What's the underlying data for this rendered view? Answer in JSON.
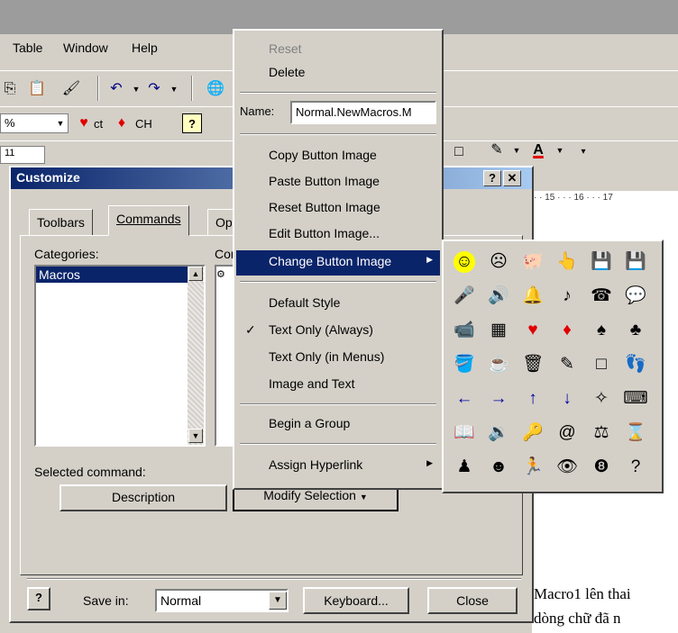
{
  "menu": {
    "table": "Table",
    "window": "Window",
    "help": "Help"
  },
  "toolbar": {
    "zoom_value": "%",
    "style_ct": "ct",
    "style_ch": "CH",
    "font_size": "11"
  },
  "ruler": {
    "text": "· · 15 · · · 16 · · · 17"
  },
  "document": {
    "line1": "Macro1 lên thai",
    "line2": "dòng chữ đã n"
  },
  "dialog": {
    "title": "Customize",
    "help_btn": "?",
    "close_btn": "✕",
    "tabs": [
      "Toolbars",
      "Commands",
      "Op"
    ],
    "categories_label": "Categories:",
    "categories_items": [
      "Macros"
    ],
    "commands_label": "Cor",
    "selected_command_label": "Selected command:",
    "description_btn": "Description",
    "modify_selection_btn": "Modify Selection",
    "save_in_label": "Save in:",
    "save_in_value": "Normal",
    "keyboard_btn": "Keyboard...",
    "close_btn_label": "Close",
    "help_icon_label": "?"
  },
  "context_menu": {
    "reset": "Reset",
    "delete": "Delete",
    "name_label": "Name:",
    "name_value": "Normal.NewMacros.M",
    "copy_button_image": "Copy Button Image",
    "paste_button_image": "Paste Button Image",
    "reset_button_image": "Reset Button Image",
    "edit_button_image": "Edit Button Image...",
    "change_button_image": "Change Button Image",
    "default_style": "Default Style",
    "text_only_always": "Text Only (Always)",
    "text_only_menus": "Text Only (in Menus)",
    "image_and_text": "Image and Text",
    "begin_group": "Begin a Group",
    "assign_hyperlink": "Assign Hyperlink"
  },
  "submenu_icons": [
    [
      "smiley-icon",
      "sad-face-icon",
      "piggy-bank-icon",
      "hand-pointer-icon",
      "floppy-disk-icon",
      "floppy-disk-alt-icon"
    ],
    [
      "microphone-icon",
      "speaker-icon",
      "bell-icon",
      "music-note-icon",
      "telephone-icon",
      "speech-bubble-icon"
    ],
    [
      "video-camera-icon",
      "calculator-icon",
      "heart-icon",
      "diamond-icon",
      "spade-icon",
      "club-icon"
    ],
    [
      "paint-bucket-icon",
      "coffee-mug-icon",
      "trash-can-icon",
      "pencil-icon",
      "blank-square-icon",
      "footprints-icon"
    ],
    [
      "arrow-left-icon",
      "arrow-right-icon",
      "arrow-up-icon",
      "arrow-down-icon",
      "magic-wand-icon",
      "keyboard-icon"
    ],
    [
      "book-icon",
      "sound-waves-icon",
      "key-icon",
      "fingerprint-icon",
      "scales-icon",
      "hourglass-icon"
    ],
    [
      "person-icon",
      "head-profile-icon",
      "runner-icon",
      "eye-icon",
      "eight-ball-icon",
      "question-mark-icon"
    ]
  ],
  "submenu_glyphs": [
    [
      "☺",
      "☹",
      "🐖",
      "👆",
      "💾",
      "💾"
    ],
    [
      "🎤",
      "🔊",
      "🔔",
      "♪",
      "☎",
      "💬"
    ],
    [
      "📹",
      "▦",
      "♥",
      "♦",
      "♠",
      "♣"
    ],
    [
      "🪣",
      "☕",
      "🗑",
      "✎",
      "□",
      "👣"
    ],
    [
      "←",
      "→",
      "↑",
      "↓",
      "✧",
      "⌨"
    ],
    [
      "📖",
      "🔉",
      "🔑",
      "@",
      "⚖",
      "⌛"
    ],
    [
      "♟",
      "☻",
      "🏃",
      "👁",
      "❽",
      "?"
    ]
  ],
  "colors": {
    "highlight": "#0a246a",
    "heart": "#e00000",
    "diamond": "#e00000",
    "arrow_blue": "#0000a0",
    "smiley": "#ffff00",
    "face_bg": "#d4d0c8"
  }
}
